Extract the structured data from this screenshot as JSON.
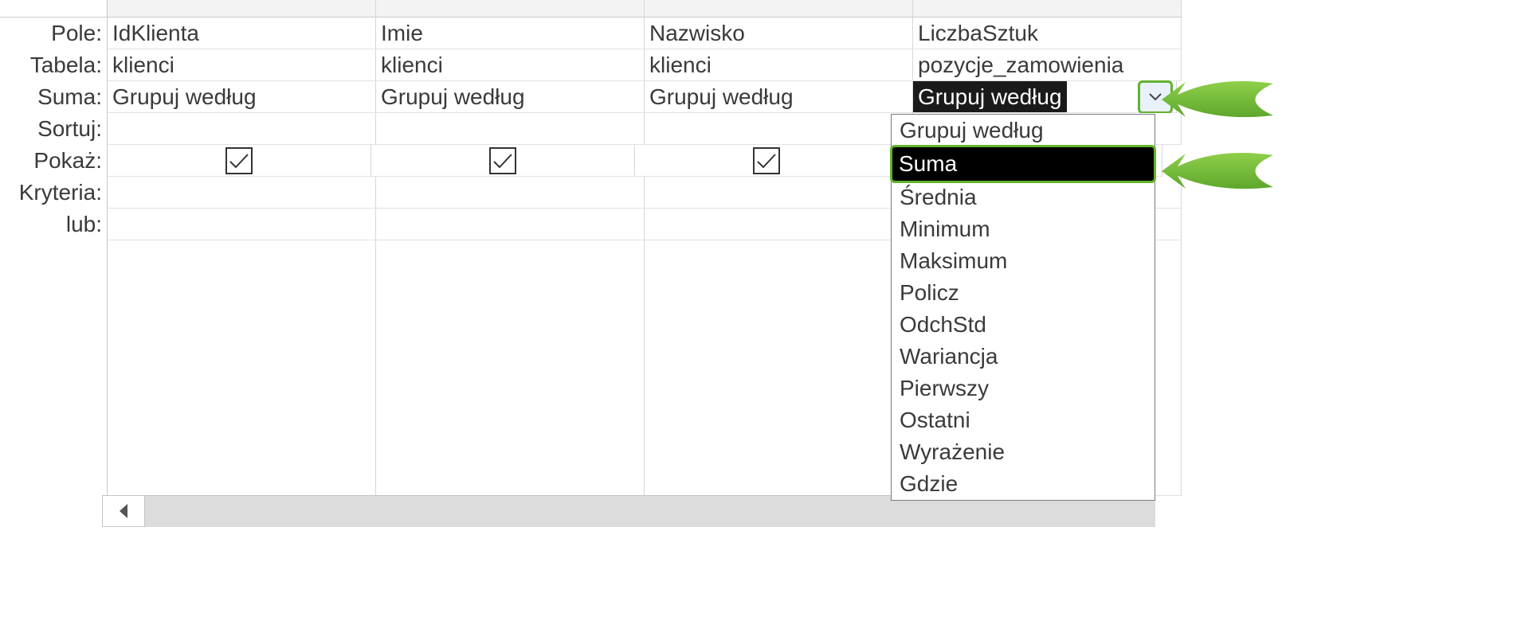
{
  "row_labels": {
    "pole": "Pole:",
    "tabela": "Tabela:",
    "suma": "Suma:",
    "sortuj": "Sortuj:",
    "pokaz": "Pokaż:",
    "kryteria": "Kryteria:",
    "lub": "lub:"
  },
  "columns": [
    {
      "pole": "IdKlienta",
      "tabela": "klienci",
      "suma": "Grupuj według",
      "sortuj": "",
      "pokaz": true,
      "kryteria": "",
      "lub": ""
    },
    {
      "pole": "Imie",
      "tabela": "klienci",
      "suma": "Grupuj według",
      "sortuj": "",
      "pokaz": true,
      "kryteria": "",
      "lub": ""
    },
    {
      "pole": "Nazwisko",
      "tabela": "klienci",
      "suma": "Grupuj według",
      "sortuj": "",
      "pokaz": true,
      "kryteria": "",
      "lub": ""
    },
    {
      "pole": "LiczbaSztuk",
      "tabela": "pozycje_zamowienia",
      "suma": "Grupuj według",
      "sortuj": "",
      "pokaz": true,
      "kryteria": "",
      "lub": ""
    }
  ],
  "active_column_index": 3,
  "dropdown": {
    "selected": "Grupuj według",
    "highlighted": "Suma",
    "options": [
      "Grupuj według",
      "Suma",
      "Średnia",
      "Minimum",
      "Maksimum",
      "Policz",
      "OdchStd",
      "Wariancja",
      "Pierwszy",
      "Ostatni",
      "Wyrażenie",
      "Gdzie"
    ]
  }
}
